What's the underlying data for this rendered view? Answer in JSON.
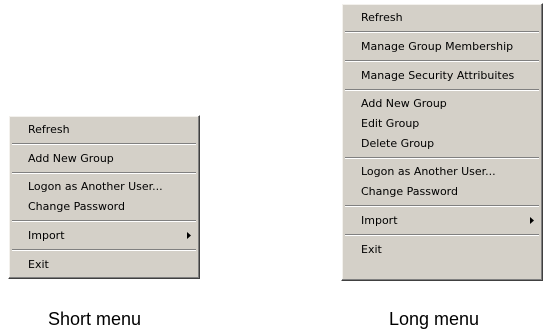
{
  "short_menu": {
    "items": [
      {
        "label": "Refresh"
      },
      {
        "label": "Add New Group"
      },
      {
        "label": "Logon as Another User..."
      },
      {
        "label": "Change Password"
      },
      {
        "label": "Import"
      },
      {
        "label": "Exit"
      }
    ],
    "caption": "Short menu"
  },
  "long_menu": {
    "items": [
      {
        "label": "Refresh"
      },
      {
        "label": "Manage Group Membership"
      },
      {
        "label": "Manage Security Attribuites"
      },
      {
        "label": "Add New Group"
      },
      {
        "label": "Edit Group"
      },
      {
        "label": "Delete Group"
      },
      {
        "label": "Logon as Another User..."
      },
      {
        "label": "Change Password"
      },
      {
        "label": "Import"
      },
      {
        "label": "Exit"
      }
    ],
    "caption": "Long menu"
  },
  "icons": {
    "submenu_arrow": "triangle-right-icon"
  },
  "colors": {
    "menu_background": "#d4d0c8",
    "separator_dark": "#808080",
    "separator_light": "#ffffff",
    "text": "#000000"
  }
}
